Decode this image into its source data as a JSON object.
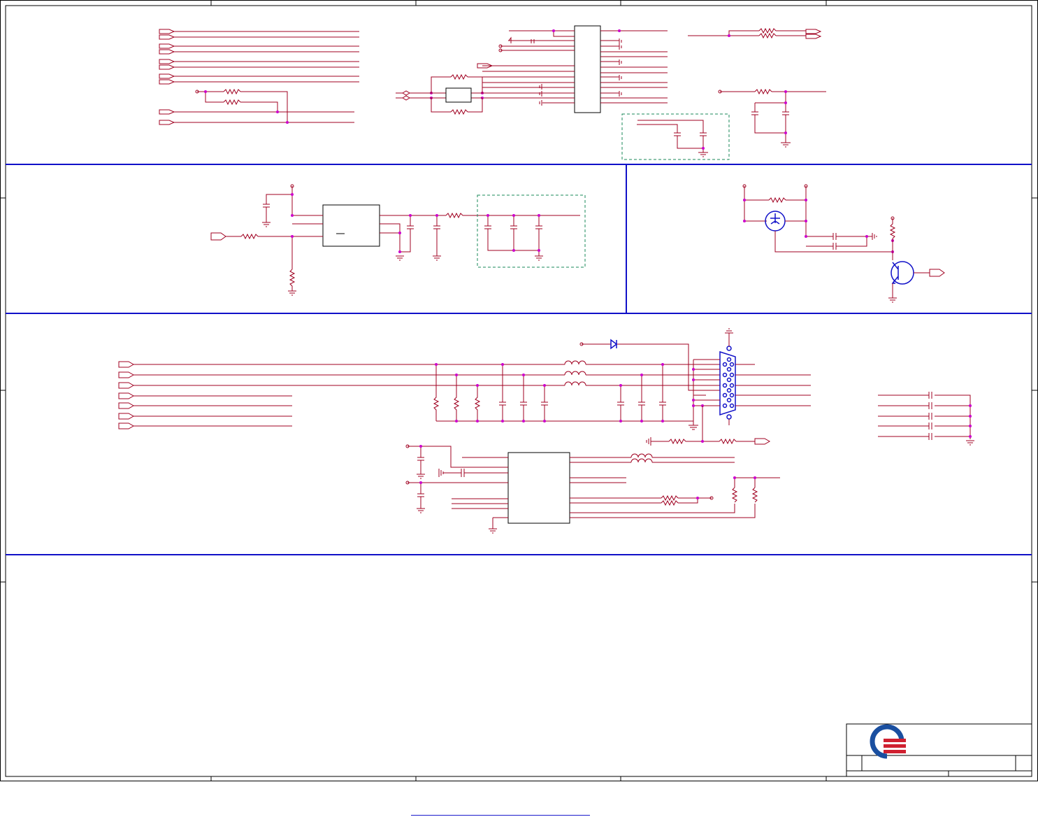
{
  "document": {
    "type": "electrical-schematic",
    "sections": [
      "top-interfaces",
      "power-regulator",
      "power-switch",
      "vga-output",
      "blank-area"
    ]
  },
  "colors": {
    "wire": "#a00020",
    "junction": "#cc00cc",
    "component": "#1010c8",
    "frame": "#000000",
    "keepout_box": "#1a8a5a",
    "logo_blue": "#1a4fa0",
    "logo_red": "#d02030"
  },
  "title_block": {
    "logo": "quanta-logo"
  },
  "footer": {
    "link_text": ""
  }
}
